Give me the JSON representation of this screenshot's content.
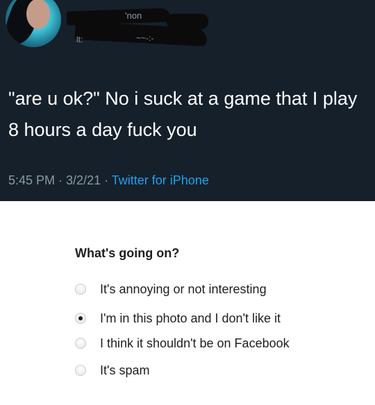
{
  "tweet": {
    "text": "\"are u ok?\" No i suck at a game that I play 8 hours a day fuck you",
    "time": "5:45 PM",
    "separator1": " · ",
    "date": "3/2/21",
    "separator2": " · ",
    "source": "Twitter for iPhone",
    "redacted_name_fragment": "'non",
    "redacted_handle_fragment": "lt:",
    "redacted_handle_fragment2": "~~-:-"
  },
  "report": {
    "title": "What's going on?",
    "options": [
      {
        "label": "It's annoying or not interesting",
        "selected": false
      },
      {
        "label": "I'm in this photo and I don't like it",
        "selected": true
      },
      {
        "label": "I think it shouldn't be on Facebook",
        "selected": false
      },
      {
        "label": "It's spam",
        "selected": false
      }
    ]
  },
  "colors": {
    "tweet_background": "#15202b",
    "tweet_text": "#ffffff",
    "meta_text": "#8899a6",
    "link": "#1da1f2",
    "report_text": "#1c1e21"
  }
}
